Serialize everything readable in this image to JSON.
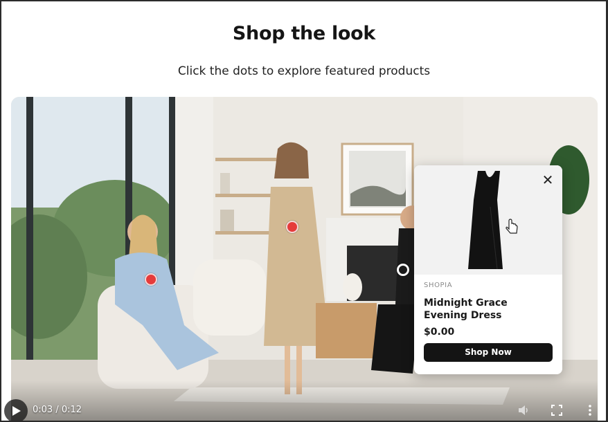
{
  "page": {
    "title": "Shop the look",
    "subtitle": "Click the dots to explore featured products"
  },
  "hotspots": [
    {
      "id": "blue-dress",
      "state": "inactive"
    },
    {
      "id": "trench-coat",
      "state": "inactive"
    },
    {
      "id": "black-dress",
      "state": "active"
    }
  ],
  "product_card": {
    "brand": "SHOPIA",
    "name": "Midnight Grace Evening Dress",
    "price": "$0.00",
    "cta_label": "Shop Now",
    "close_icon": "close-icon"
  },
  "video_controls": {
    "time": "0:03 / 0:12",
    "icons": [
      "play-icon",
      "volume-icon",
      "fullscreen-icon",
      "more-options-icon"
    ]
  },
  "colors": {
    "hotspot": "#e53b3b",
    "cta_background": "#141414",
    "brand_text": "#8a8a8a"
  }
}
